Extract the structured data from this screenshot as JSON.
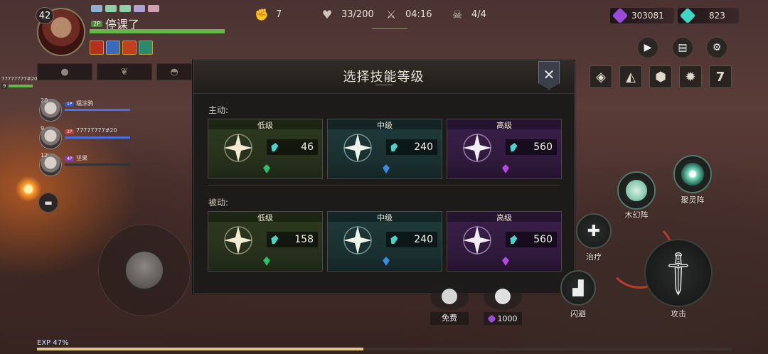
{
  "player": {
    "level": "42",
    "name": "停课了",
    "tag": "2P",
    "hp_fraction": 1.0
  },
  "top": {
    "stat1": "7",
    "hp": "33/200",
    "time": "04:16",
    "count": "4/4"
  },
  "currency": {
    "purple": "303081",
    "teal": "823"
  },
  "side": {
    "name": "77777777#20",
    "level": "9"
  },
  "team": [
    {
      "level": "20",
      "tag": "1P",
      "name": "糯涂鸦",
      "tag_color": "#3a55c0"
    },
    {
      "level": "9",
      "tag": "2P",
      "name": "77777777#20",
      "tag_color": "#b83a3a"
    },
    {
      "level": "12",
      "tag": "4P",
      "name": "坚果",
      "tag_color": "#8a3ab8"
    }
  ],
  "skill_row": {
    "last_label": "7"
  },
  "modal": {
    "title": "选择技能等级",
    "close": "✕",
    "active_label": "主动:",
    "passive_label": "被动:",
    "active": [
      {
        "label": "低级",
        "cost": "46"
      },
      {
        "label": "中级",
        "cost": "240"
      },
      {
        "label": "高级",
        "cost": "560"
      }
    ],
    "passive": [
      {
        "label": "低级",
        "cost": "158"
      },
      {
        "label": "中级",
        "cost": "240"
      },
      {
        "label": "高级",
        "cost": "560"
      }
    ]
  },
  "actions": {
    "wood": "木幻阵",
    "gather": "聚灵阵",
    "heal": "治疗",
    "dodge": "闪避",
    "attack": "攻击",
    "free": "免费",
    "price": "1000"
  },
  "exp": {
    "label": "EXP 47%",
    "fraction": 0.47
  },
  "colors": {
    "accent_purple": "#9a4ad6",
    "accent_teal": "#3fd6c6",
    "hp_green": "#63b84a"
  },
  "icons": [
    "fist-icon",
    "heart-icon",
    "crossed-swords-icon",
    "skull-icon",
    "play-icon",
    "chat-icon",
    "gear-icon",
    "close-icon"
  ]
}
